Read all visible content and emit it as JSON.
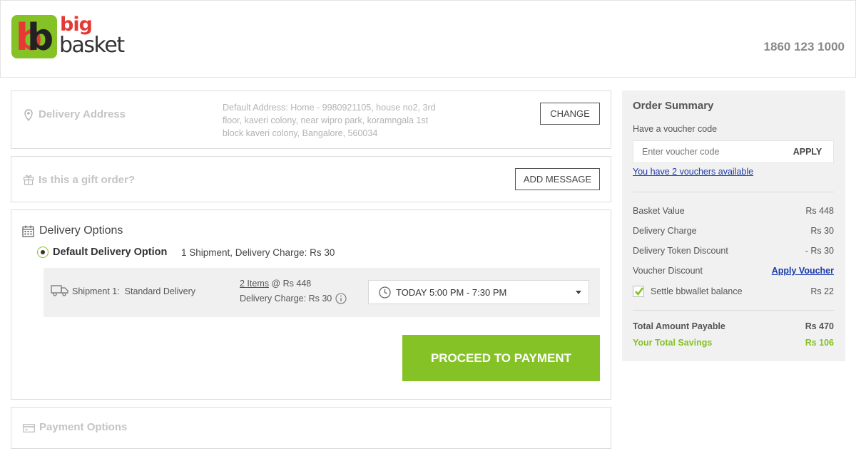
{
  "header": {
    "logo": {
      "line1": "big",
      "line2": "basket"
    },
    "phone": "1860 123 1000"
  },
  "delivery_address": {
    "title": "Delivery Address",
    "address": "Default Address: Home - 9980921105, house no2, 3rd floor, kaveri colony, near wipro park, koramngala 1st block kaveri colony, Bangalore, 560034",
    "change_label": "CHANGE"
  },
  "gift": {
    "title": "Is this a gift order?",
    "add_message_label": "ADD MESSAGE"
  },
  "delivery_options": {
    "title": "Delivery Options",
    "default_option_label": "Default Delivery Option",
    "default_option_detail": "1 Shipment, Delivery Charge: Rs 30",
    "shipment": {
      "label": "Shipment 1:  Standard Delivery",
      "items_link": "2 Items",
      "items_price": " @ Rs 448",
      "delivery_charge": "Delivery Charge: Rs 30",
      "slot": "TODAY 5:00 PM - 7:30 PM"
    },
    "proceed_label": "PROCEED TO PAYMENT"
  },
  "payment_options": {
    "title": "Payment Options"
  },
  "order_summary": {
    "title": "Order Summary",
    "voucher_prompt": "Have a voucher code",
    "voucher_placeholder": "Enter voucher code",
    "apply_label": "APPLY",
    "vouchers_available": "You have 2 vouchers available",
    "rows": [
      {
        "label": "Basket Value",
        "value": "Rs 448"
      },
      {
        "label": "Delivery Charge",
        "value": "Rs 30"
      },
      {
        "label": "Delivery Token Discount",
        "value": "- Rs 30"
      },
      {
        "label": "Voucher Discount",
        "value": "Apply Voucher"
      }
    ],
    "bbwallet": {
      "label": "Settle bbwallet balance",
      "value": "Rs 22",
      "checked": true
    },
    "total_label": "Total Amount Payable",
    "total_value": "Rs 470",
    "savings_label": "Your Total Savings",
    "savings_value": "Rs 106"
  },
  "colors": {
    "brand_green": "#84c225",
    "brand_red": "#e53935",
    "link_blue": "#1a3bab"
  }
}
